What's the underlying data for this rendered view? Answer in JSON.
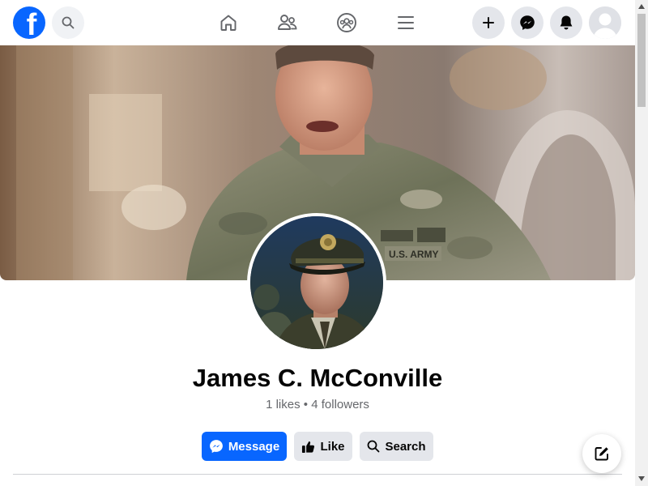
{
  "header": {
    "logo_letter": "f",
    "nav_icons": [
      "home-icon",
      "friends-icon",
      "groups-icon",
      "menu-icon"
    ],
    "right_icons": [
      "plus-icon",
      "messenger-icon",
      "bell-icon"
    ]
  },
  "profile": {
    "name": "James C. McConville",
    "likes_count": "1",
    "likes_label": "likes",
    "separator": "•",
    "followers_count": "4",
    "followers_label": "followers"
  },
  "actions": {
    "message_label": "Message",
    "like_label": "Like",
    "search_label": "Search"
  },
  "colors": {
    "brand": "#0866ff",
    "secondary_button": "#e4e6eb",
    "muted_text": "#65676b"
  }
}
